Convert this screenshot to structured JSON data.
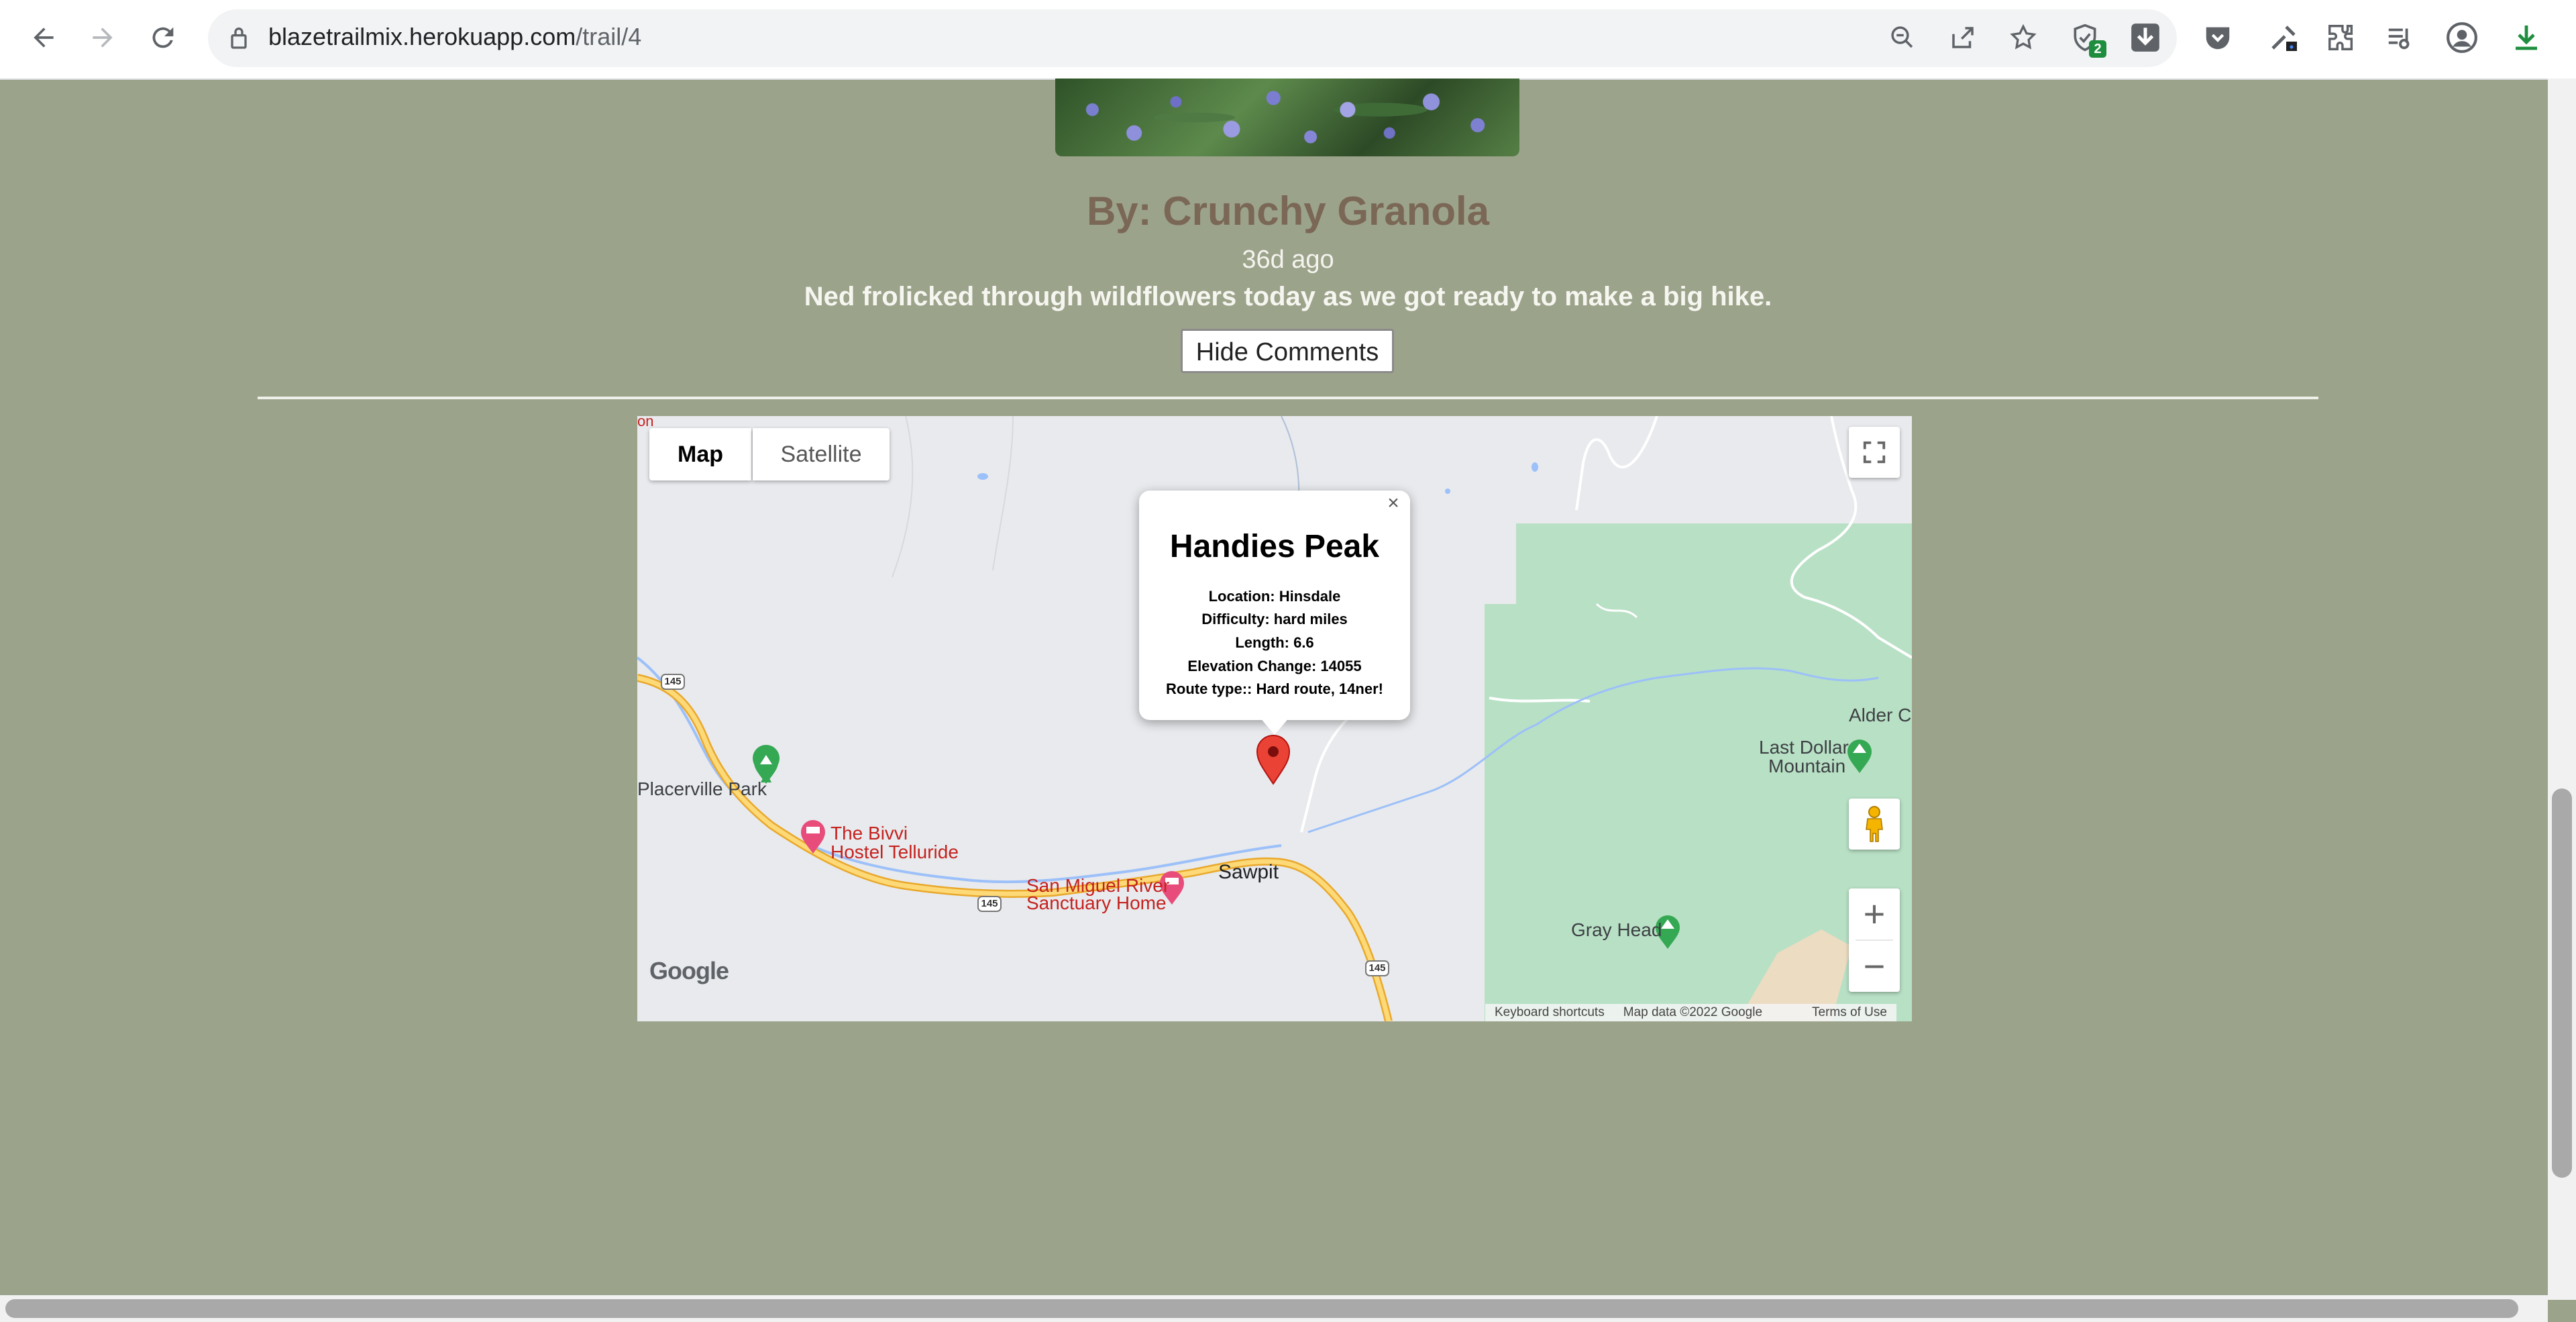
{
  "browser": {
    "url_host": "blazetrailmix.herokuapp.com",
    "url_path": "/trail/4",
    "extension_badge": "2"
  },
  "post": {
    "author": "By: Crunchy Granola",
    "posted": "36d ago",
    "caption": "Ned frolicked through wildflowers today as we got ready to make a big hike.",
    "hide_comments_label": "Hide Comments"
  },
  "map": {
    "type_map_label": "Map",
    "type_satellite_label": "Satellite",
    "zoom_in": "+",
    "zoom_out": "−",
    "logo": "Google",
    "footer": {
      "shortcuts": "Keyboard shortcuts",
      "data": "Map data ©2022 Google",
      "terms": "Terms of Use"
    },
    "places": {
      "placerville": "Placerville Park",
      "bivvi_1": "The Bivvi",
      "bivvi_2": "Hostel Telluride",
      "sanmiguel_1": "San Miguel River",
      "sanmiguel_2": "Sanctuary Home",
      "sawpit": "Sawpit",
      "alder": "Alder Cr",
      "lastdollar_1": "Last Dollar",
      "lastdollar_2": "Mountain",
      "grayhead": "Gray Head",
      "edge_fragment": "on"
    },
    "route_shields": [
      "145",
      "145",
      "145"
    ],
    "info_window": {
      "close": "×",
      "title": "Handies Peak",
      "location": "Location: Hinsdale",
      "difficulty": "Difficulty: hard miles",
      "length": "Length: 6.6",
      "elevation": "Elevation Change: 14055",
      "route_type": "Route type:: Hard route, 14ner!"
    }
  },
  "colors": {
    "page_bg": "#9ca38b",
    "author": "#7a6755",
    "map_land": "#e8eaed",
    "map_park": "#b8e0c5",
    "highway": "#f3c54a",
    "water": "#9cc0f9",
    "marker": "#ea4335"
  }
}
